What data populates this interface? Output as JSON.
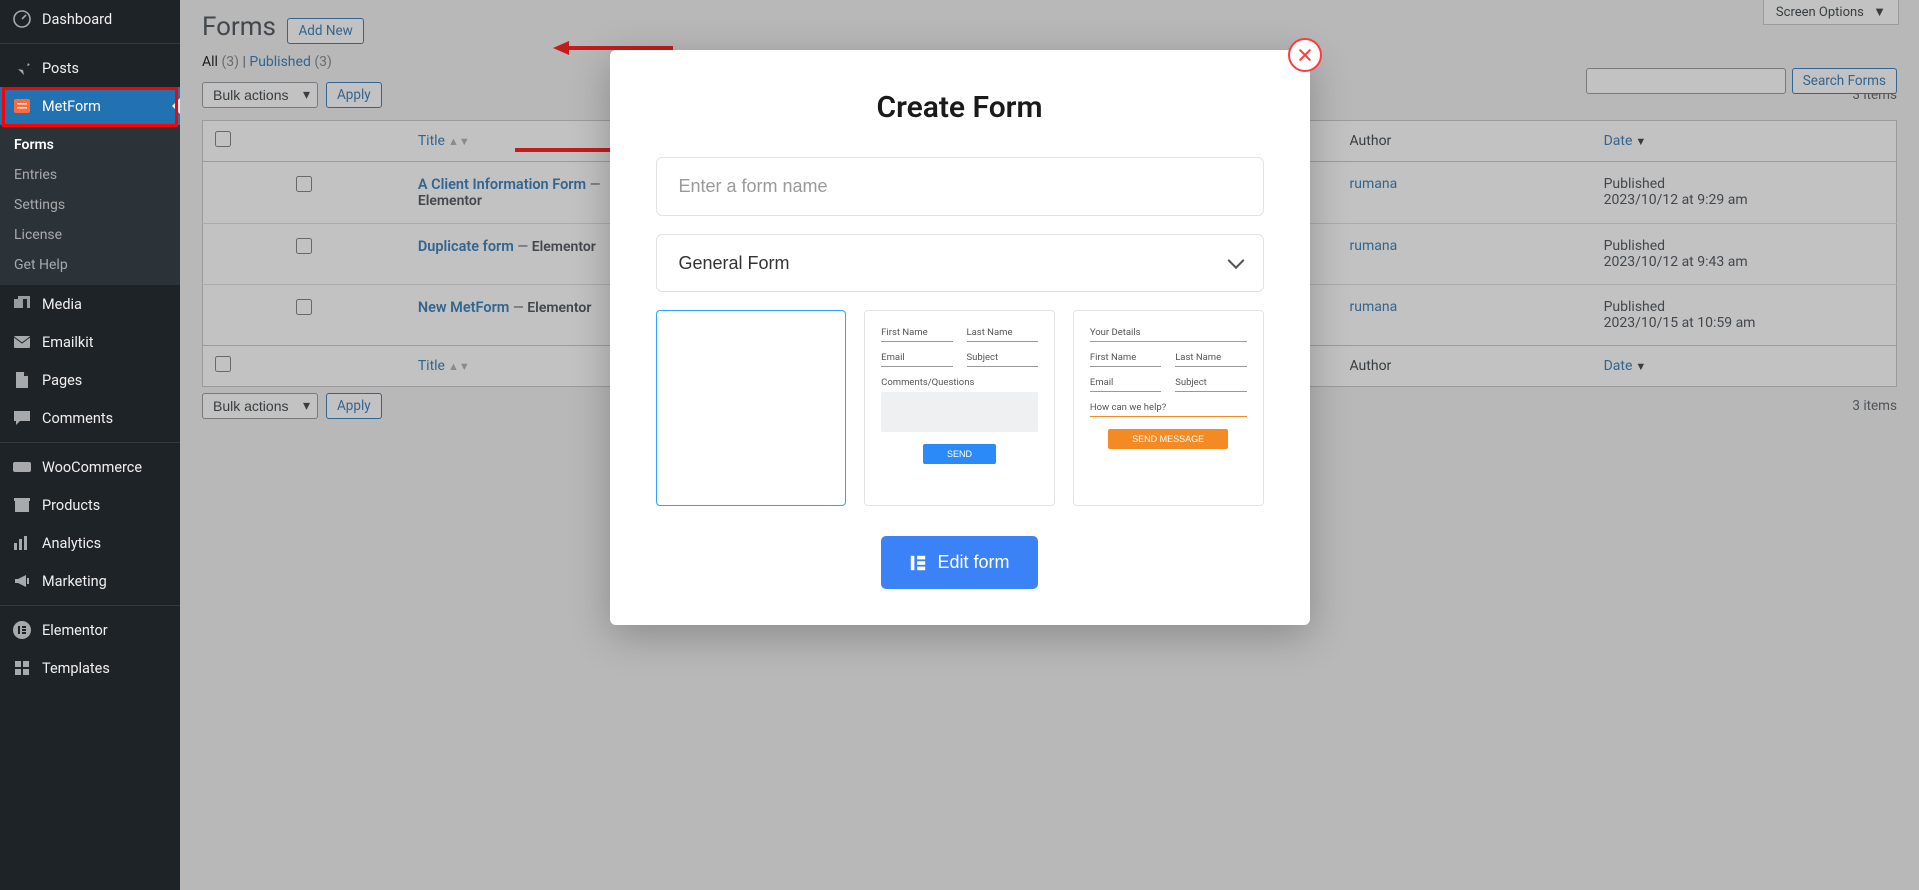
{
  "sidebar": {
    "items": [
      {
        "label": "Dashboard",
        "name": "dashboard"
      },
      {
        "label": "Posts",
        "name": "posts"
      },
      {
        "label": "MetForm",
        "name": "metform",
        "active": true
      },
      {
        "label": "Media",
        "name": "media"
      },
      {
        "label": "Emailkit",
        "name": "emailkit"
      },
      {
        "label": "Pages",
        "name": "pages"
      },
      {
        "label": "Comments",
        "name": "comments"
      },
      {
        "label": "WooCommerce",
        "name": "woocommerce"
      },
      {
        "label": "Products",
        "name": "products"
      },
      {
        "label": "Analytics",
        "name": "analytics"
      },
      {
        "label": "Marketing",
        "name": "marketing"
      },
      {
        "label": "Elementor",
        "name": "elementor"
      },
      {
        "label": "Templates",
        "name": "templates"
      }
    ],
    "submenu": [
      {
        "label": "Forms",
        "active": true
      },
      {
        "label": "Entries"
      },
      {
        "label": "Settings"
      },
      {
        "label": "License"
      },
      {
        "label": "Get Help"
      }
    ]
  },
  "header": {
    "screen_options": "Screen Options",
    "title": "Forms",
    "add_new": "Add New"
  },
  "filters": {
    "all": "All",
    "all_count": "(3)",
    "sep": " | ",
    "published": "Published",
    "published_count": "(3)"
  },
  "bulk": {
    "label": "Bulk actions",
    "apply": "Apply"
  },
  "search": {
    "placeholder": "",
    "button": "Search Forms"
  },
  "items_count": "3 items",
  "table": {
    "headers": {
      "title": "Title",
      "author": "Author",
      "date": "Date"
    },
    "rows": [
      {
        "title": "A Client Information Form",
        "sub": "Elementor",
        "dash": " — ",
        "author": "rumana",
        "status": "Published",
        "date": "2023/10/12 at 9:29 am"
      },
      {
        "title": "Duplicate form",
        "sub": "Elementor",
        "dash": " — ",
        "author": "rumana",
        "status": "Published",
        "date": "2023/10/12 at 9:43 am",
        "inline": true
      },
      {
        "title": "New MetForm",
        "sub": "Elementor",
        "dash": " — ",
        "author": "rumana",
        "status": "Published",
        "date": "2023/10/15 at 10:59 am",
        "inline": true
      }
    ]
  },
  "modal": {
    "title": "Create Form",
    "name_placeholder": "Enter a form name",
    "form_type": "General Form",
    "edit_button": "Edit form",
    "tpl2": {
      "f1": "First Name",
      "f2": "Last Name",
      "f3": "Email",
      "f4": "Subject",
      "q": "Comments/Questions",
      "btn": "SEND"
    },
    "tpl3": {
      "head": "Your Details",
      "f1": "First Name",
      "f2": "Last Name",
      "f3": "Email",
      "f4": "Subject",
      "q": "How can we help?",
      "btn": "SEND MESSAGE"
    }
  }
}
